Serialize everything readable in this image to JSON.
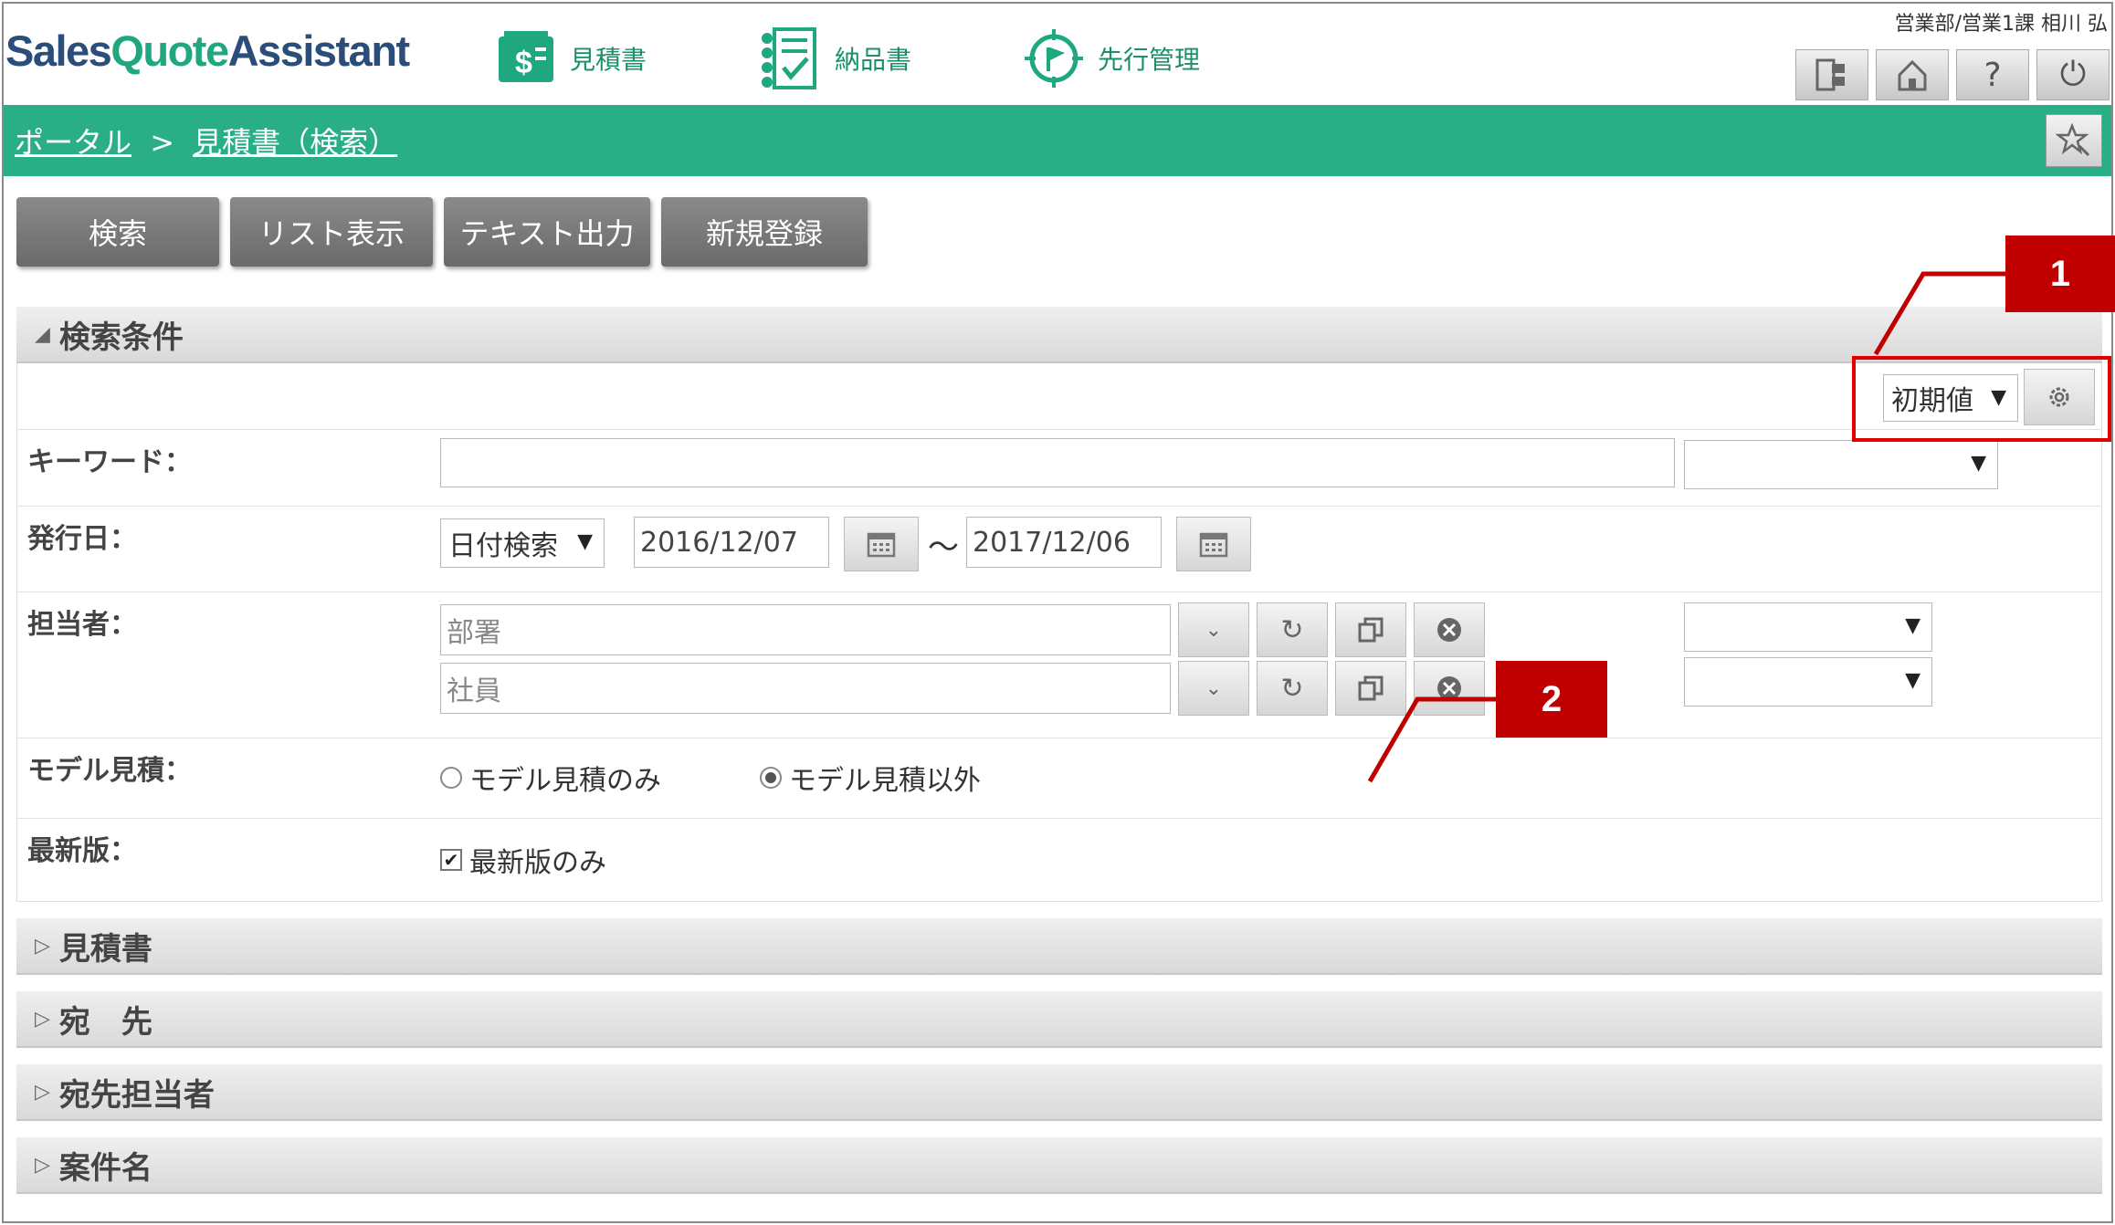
{
  "app": {
    "logo_sales": "Sales",
    "logo_quote": "Quote",
    "logo_assistant": "Assistant",
    "user_info": "営業部/営業1課 相川 弘"
  },
  "nav": [
    {
      "label": "見積書",
      "icon": "quote-dollar-icon"
    },
    {
      "label": "納品書",
      "icon": "delivery-checklist-icon"
    },
    {
      "label": "先行管理",
      "icon": "flag-target-icon"
    }
  ],
  "header_buttons": [
    {
      "icon": "switch-window-icon"
    },
    {
      "icon": "home-icon"
    },
    {
      "icon": "help-icon",
      "glyph": "?"
    },
    {
      "icon": "power-icon",
      "glyph": "⏻"
    }
  ],
  "breadcrumb": {
    "portal": "ポータル",
    "separator": ">",
    "current": "見積書（検索）"
  },
  "actions": {
    "search": "検索",
    "list": "リスト表示",
    "text_export": "テキスト出力",
    "new": "新規登録"
  },
  "search_section": {
    "title": "検索条件",
    "preset_select": "初期値",
    "keyword_label": "キーワード：",
    "keyword_value": "",
    "keyword_option": "",
    "issue_date_label": "発行日：",
    "date_mode": "日付検索",
    "date_from": "2016/12/07",
    "tilde": "～",
    "date_to": "2017/12/06",
    "staff_label": "担当者：",
    "dept_placeholder": "部署",
    "employee_placeholder": "社員",
    "model_label": "モデル見積：",
    "model_only": "モデル見積のみ",
    "model_except": "モデル見積以外",
    "model_selected": "model_except",
    "latest_label": "最新版：",
    "latest_only": "最新版のみ",
    "latest_checked": true
  },
  "collapsed_sections": [
    {
      "title": "見積書"
    },
    {
      "title": "宛　先"
    },
    {
      "title": "宛先担当者"
    },
    {
      "title": "案件名"
    }
  ],
  "callouts": {
    "one": "1",
    "two": "2"
  },
  "colors": {
    "brand_green": "#2aae85",
    "logo_blue": "#2a4d7a",
    "callout_red": "#c00000"
  }
}
